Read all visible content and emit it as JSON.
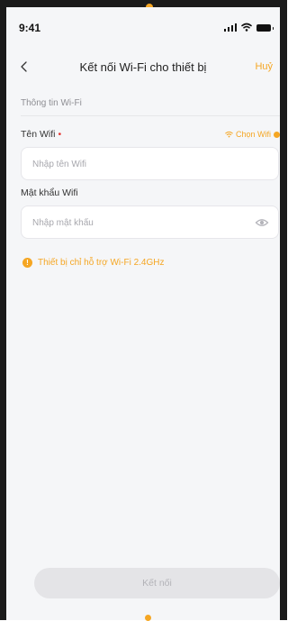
{
  "status_bar": {
    "time": "9:41",
    "signal_icon": "cellular-signal-icon",
    "wifi_icon": "wifi-icon",
    "battery_icon": "battery-icon"
  },
  "header": {
    "back_icon": "chevron-left-icon",
    "title": "Kết nối Wi-Fi cho thiết bị",
    "cancel_label": "Huỷ"
  },
  "section": {
    "title": "Thông tin Wi-Fi"
  },
  "wifi_name": {
    "label": "Tên Wifi",
    "required_mark": "•",
    "choose_label": "Chọn Wifi",
    "placeholder": "Nhập tên Wifi",
    "value": ""
  },
  "wifi_password": {
    "label": "Mật khẩu Wifi",
    "placeholder": "Nhập mật khẩu",
    "value": "",
    "visibility_icon": "eye-icon"
  },
  "hint": {
    "icon": "info-icon",
    "icon_glyph": "!",
    "text": "Thiết bị chỉ hỗ trợ Wi-Fi 2.4GHz"
  },
  "footer": {
    "connect_label": "Kết nối",
    "connect_enabled": false
  },
  "colors": {
    "accent": "#f5a623",
    "required": "#e53935",
    "background": "#f5f6f8",
    "button_disabled": "#e4e4e7"
  }
}
